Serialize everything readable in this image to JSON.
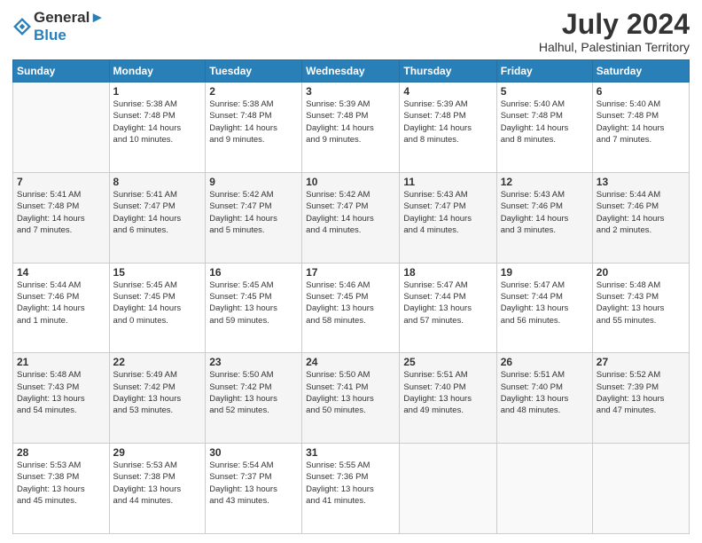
{
  "header": {
    "logo_line1": "General",
    "logo_line2": "Blue",
    "main_title": "July 2024",
    "subtitle": "Halhul, Palestinian Territory"
  },
  "calendar": {
    "days_of_week": [
      "Sunday",
      "Monday",
      "Tuesday",
      "Wednesday",
      "Thursday",
      "Friday",
      "Saturday"
    ],
    "weeks": [
      [
        {
          "day": "",
          "info": ""
        },
        {
          "day": "1",
          "info": "Sunrise: 5:38 AM\nSunset: 7:48 PM\nDaylight: 14 hours\nand 10 minutes."
        },
        {
          "day": "2",
          "info": "Sunrise: 5:38 AM\nSunset: 7:48 PM\nDaylight: 14 hours\nand 9 minutes."
        },
        {
          "day": "3",
          "info": "Sunrise: 5:39 AM\nSunset: 7:48 PM\nDaylight: 14 hours\nand 9 minutes."
        },
        {
          "day": "4",
          "info": "Sunrise: 5:39 AM\nSunset: 7:48 PM\nDaylight: 14 hours\nand 8 minutes."
        },
        {
          "day": "5",
          "info": "Sunrise: 5:40 AM\nSunset: 7:48 PM\nDaylight: 14 hours\nand 8 minutes."
        },
        {
          "day": "6",
          "info": "Sunrise: 5:40 AM\nSunset: 7:48 PM\nDaylight: 14 hours\nand 7 minutes."
        }
      ],
      [
        {
          "day": "7",
          "info": "Sunrise: 5:41 AM\nSunset: 7:48 PM\nDaylight: 14 hours\nand 7 minutes."
        },
        {
          "day": "8",
          "info": "Sunrise: 5:41 AM\nSunset: 7:47 PM\nDaylight: 14 hours\nand 6 minutes."
        },
        {
          "day": "9",
          "info": "Sunrise: 5:42 AM\nSunset: 7:47 PM\nDaylight: 14 hours\nand 5 minutes."
        },
        {
          "day": "10",
          "info": "Sunrise: 5:42 AM\nSunset: 7:47 PM\nDaylight: 14 hours\nand 4 minutes."
        },
        {
          "day": "11",
          "info": "Sunrise: 5:43 AM\nSunset: 7:47 PM\nDaylight: 14 hours\nand 4 minutes."
        },
        {
          "day": "12",
          "info": "Sunrise: 5:43 AM\nSunset: 7:46 PM\nDaylight: 14 hours\nand 3 minutes."
        },
        {
          "day": "13",
          "info": "Sunrise: 5:44 AM\nSunset: 7:46 PM\nDaylight: 14 hours\nand 2 minutes."
        }
      ],
      [
        {
          "day": "14",
          "info": "Sunrise: 5:44 AM\nSunset: 7:46 PM\nDaylight: 14 hours\nand 1 minute."
        },
        {
          "day": "15",
          "info": "Sunrise: 5:45 AM\nSunset: 7:45 PM\nDaylight: 14 hours\nand 0 minutes."
        },
        {
          "day": "16",
          "info": "Sunrise: 5:45 AM\nSunset: 7:45 PM\nDaylight: 13 hours\nand 59 minutes."
        },
        {
          "day": "17",
          "info": "Sunrise: 5:46 AM\nSunset: 7:45 PM\nDaylight: 13 hours\nand 58 minutes."
        },
        {
          "day": "18",
          "info": "Sunrise: 5:47 AM\nSunset: 7:44 PM\nDaylight: 13 hours\nand 57 minutes."
        },
        {
          "day": "19",
          "info": "Sunrise: 5:47 AM\nSunset: 7:44 PM\nDaylight: 13 hours\nand 56 minutes."
        },
        {
          "day": "20",
          "info": "Sunrise: 5:48 AM\nSunset: 7:43 PM\nDaylight: 13 hours\nand 55 minutes."
        }
      ],
      [
        {
          "day": "21",
          "info": "Sunrise: 5:48 AM\nSunset: 7:43 PM\nDaylight: 13 hours\nand 54 minutes."
        },
        {
          "day": "22",
          "info": "Sunrise: 5:49 AM\nSunset: 7:42 PM\nDaylight: 13 hours\nand 53 minutes."
        },
        {
          "day": "23",
          "info": "Sunrise: 5:50 AM\nSunset: 7:42 PM\nDaylight: 13 hours\nand 52 minutes."
        },
        {
          "day": "24",
          "info": "Sunrise: 5:50 AM\nSunset: 7:41 PM\nDaylight: 13 hours\nand 50 minutes."
        },
        {
          "day": "25",
          "info": "Sunrise: 5:51 AM\nSunset: 7:40 PM\nDaylight: 13 hours\nand 49 minutes."
        },
        {
          "day": "26",
          "info": "Sunrise: 5:51 AM\nSunset: 7:40 PM\nDaylight: 13 hours\nand 48 minutes."
        },
        {
          "day": "27",
          "info": "Sunrise: 5:52 AM\nSunset: 7:39 PM\nDaylight: 13 hours\nand 47 minutes."
        }
      ],
      [
        {
          "day": "28",
          "info": "Sunrise: 5:53 AM\nSunset: 7:38 PM\nDaylight: 13 hours\nand 45 minutes."
        },
        {
          "day": "29",
          "info": "Sunrise: 5:53 AM\nSunset: 7:38 PM\nDaylight: 13 hours\nand 44 minutes."
        },
        {
          "day": "30",
          "info": "Sunrise: 5:54 AM\nSunset: 7:37 PM\nDaylight: 13 hours\nand 43 minutes."
        },
        {
          "day": "31",
          "info": "Sunrise: 5:55 AM\nSunset: 7:36 PM\nDaylight: 13 hours\nand 41 minutes."
        },
        {
          "day": "",
          "info": ""
        },
        {
          "day": "",
          "info": ""
        },
        {
          "day": "",
          "info": ""
        }
      ]
    ]
  }
}
